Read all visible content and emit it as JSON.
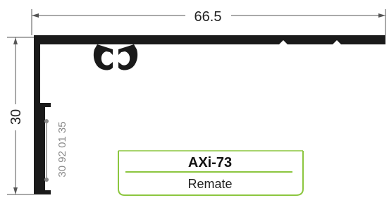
{
  "dimensions": {
    "width_label": "66.5",
    "height_label": "30"
  },
  "part_code": "30 92 01 35",
  "label_box": {
    "title": "AXi-73",
    "subtitle": "Remate",
    "border_color": "#8cc63f"
  },
  "profile_color": "#1a1a1a"
}
